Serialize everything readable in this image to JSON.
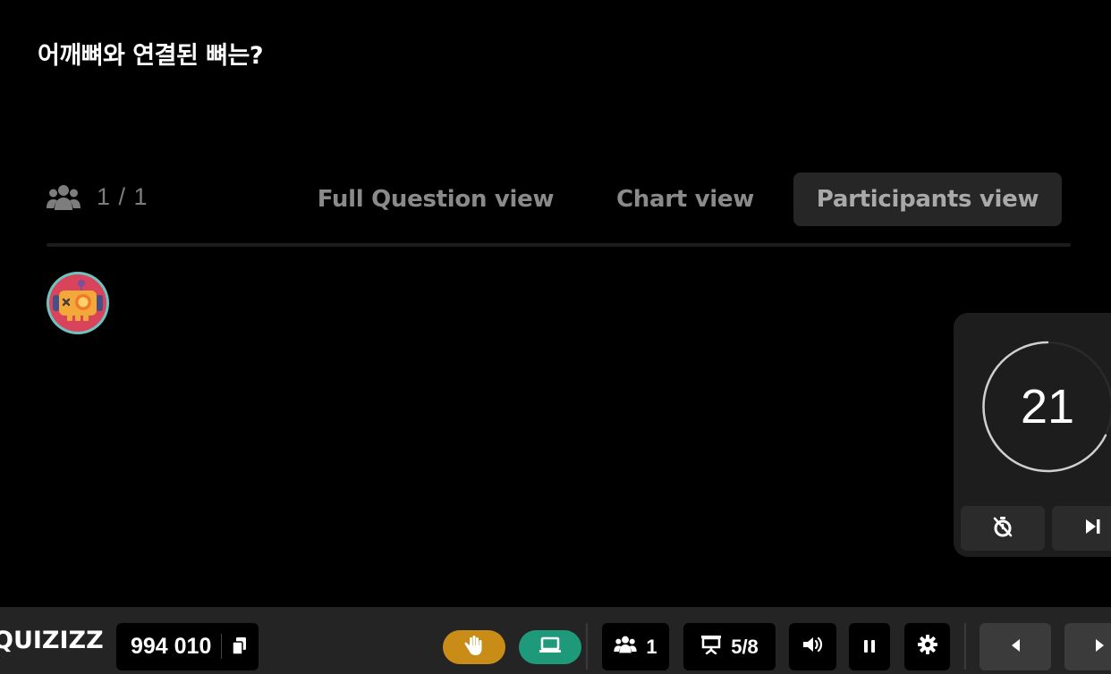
{
  "question": {
    "text": "어깨뼈와 연결된 뼈는?"
  },
  "participants": {
    "count_text": "1 / 1"
  },
  "tabs": [
    {
      "label": "Full Question view",
      "active": false
    },
    {
      "label": "Chart view",
      "active": false
    },
    {
      "label": "Participants view",
      "active": true
    }
  ],
  "participant_list": [
    {
      "avatar": "robot-avatar"
    }
  ],
  "timer": {
    "value": "21"
  },
  "bottom_bar": {
    "logo": "QUIZIZZ",
    "join_code": "994 010",
    "player_count": "1",
    "slide_progress": "5/8"
  },
  "colors": {
    "background": "#000000",
    "bar": "#242424",
    "hand_button": "#c98d17",
    "screen_button": "#1e9a7a",
    "active_tab": "#262626"
  },
  "icons": [
    "users-icon",
    "copy-icon",
    "hand-icon",
    "screen-icon",
    "presentation-icon",
    "volume-icon",
    "pause-icon",
    "gear-icon",
    "chevron-left-icon",
    "chevron-right-icon",
    "timer-off-icon",
    "skip-icon"
  ]
}
